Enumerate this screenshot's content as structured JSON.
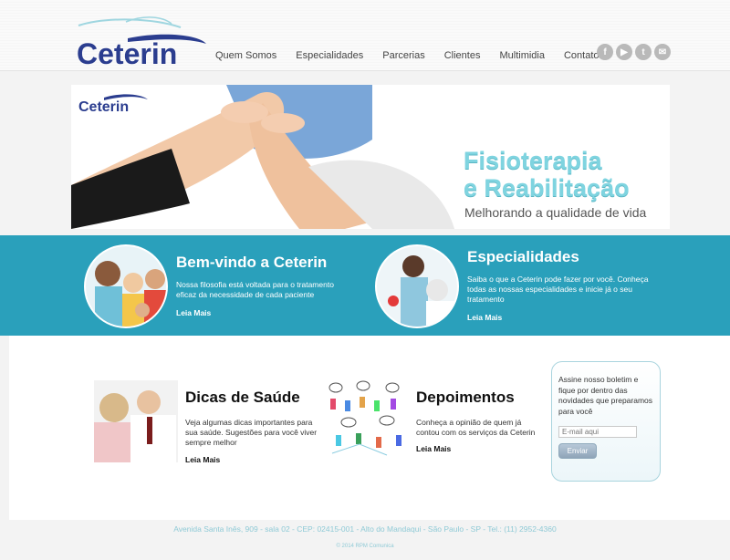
{
  "brand": {
    "name": "Ceterin"
  },
  "nav": {
    "items": [
      {
        "label": "Quem Somos"
      },
      {
        "label": "Especialidades"
      },
      {
        "label": "Parcerias"
      },
      {
        "label": "Clientes"
      },
      {
        "label": "Multimidia"
      },
      {
        "label": "Contato"
      }
    ]
  },
  "social": {
    "icons": [
      "facebook-icon",
      "youtube-icon",
      "twitter-icon",
      "email-icon"
    ],
    "glyphs": [
      "f",
      "▶",
      "t",
      "✉"
    ]
  },
  "banner": {
    "title_line1": "Fisioterapia",
    "title_line2": "e Reabilitação",
    "subtitle": "Melhorando a qualidade de vida"
  },
  "features": {
    "welcome": {
      "title": "Bem-vindo a Ceterin",
      "text": "Nossa filosofia está voltada para o tratamento eficaz da necessidade de cada paciente",
      "link": "Leia Mais"
    },
    "specialties": {
      "title": "Especialidades",
      "text": "Saiba o que a Ceterin pode fazer por você. Conheça todas as nossas especialidades e inicie já o seu tratamento",
      "link": "Leia Mais"
    }
  },
  "cards": {
    "tips": {
      "title": "Dicas de Saúde",
      "text": "Veja algumas dicas importantes para sua saúde. Sugestões para você viver sempre melhor",
      "link": "Leia Mais"
    },
    "testimonials": {
      "title": "Depoimentos",
      "text": "Conheça a opinião de quem já contou com os serviços da Ceterin",
      "link": "Leia Mais"
    }
  },
  "newsletter": {
    "text": "Assine nosso boletim e fique por dentro das novidades que preparamos para você",
    "placeholder": "E-mail aqui",
    "button": "Enviar"
  },
  "footer": {
    "address": "Avenida Santa Inês, 909 - sala 02 - CEP: 02415-001 - Alto do Mandaqui - São Paulo - SP - Tel.: (11) 2952-4360",
    "copyright": "© 2014 RPM Comunica"
  },
  "colors": {
    "teal": "#2aa0bb",
    "logo_blue": "#2b3d8f",
    "banner_title": "#7fd4e0"
  }
}
